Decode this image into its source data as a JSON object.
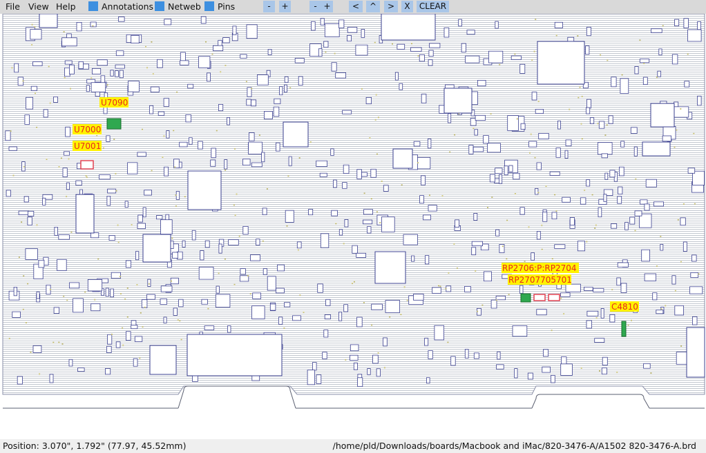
{
  "menu": {
    "file": "File",
    "view": "View",
    "help": "Help"
  },
  "toggles": {
    "annotations": {
      "label": "Annotations",
      "checked": true
    },
    "netweb": {
      "label": "Netweb",
      "checked": true
    },
    "pins": {
      "label": "Pins",
      "checked": true
    }
  },
  "toolbar": {
    "zoom_out": "-",
    "zoom_in": "+",
    "zoom_out2": "-",
    "zoom_in2": "+",
    "nav_left": "<",
    "nav_up": "^",
    "nav_right": ">",
    "close": "X",
    "clear": "CLEAR"
  },
  "annotations": {
    "u7090": "U7090",
    "u7000": "U7000",
    "u7001": "U7001",
    "rp_a": "RP2706:P:RP2704",
    "rp_b": "RP2707705701",
    "c4810": "C4810"
  },
  "colors": {
    "trace": "#b7bdc6",
    "outline": "#3a3f8f",
    "pin_green": "#2fa84f",
    "pin_red": "#e04050",
    "label_bg": "#fff200",
    "label_text": "#e8281c"
  },
  "status": {
    "position": "Position: 3.070\", 1.792\" (77.97, 45.52mm)",
    "path": "/home/pld/Downloads/boards/Macbook and iMac/820-3476-A/A1502 820-3476-A.brd"
  }
}
